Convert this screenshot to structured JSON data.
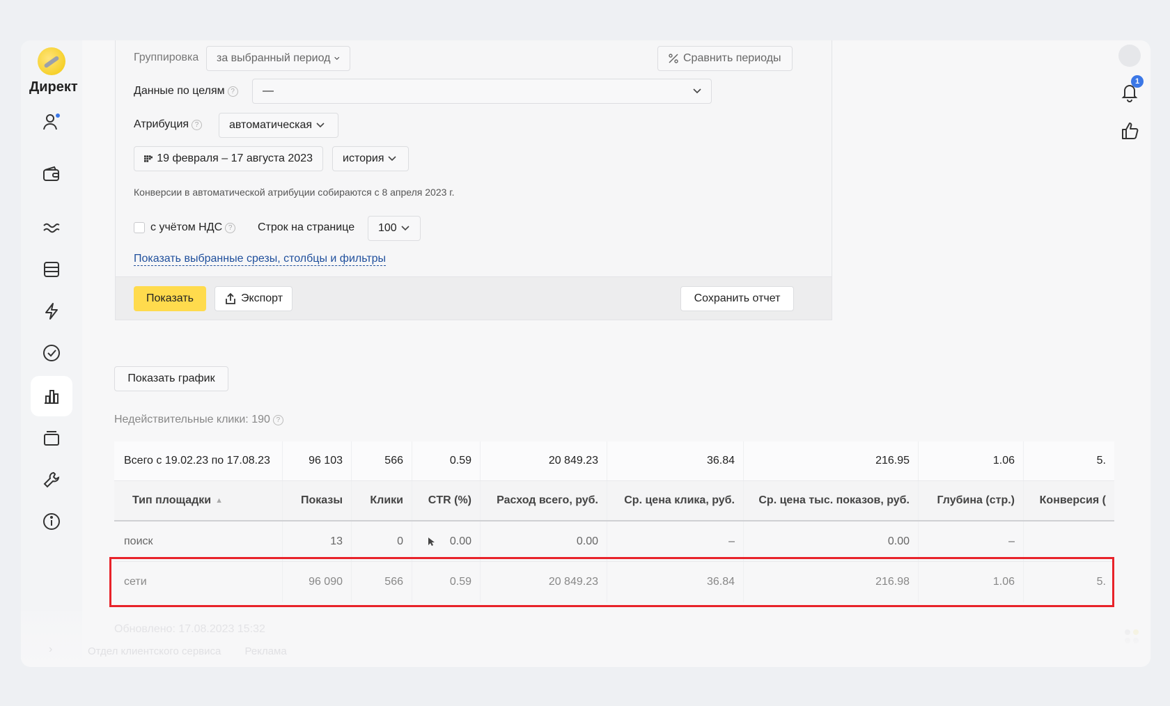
{
  "app": {
    "brand": "Директ",
    "notifications_count": "1"
  },
  "filters": {
    "grouping_label": "Группировка",
    "grouping_value": "за выбранный период",
    "compare_label": "Сравнить периоды",
    "goals_label": "Данные по целям",
    "goals_value": "—",
    "attribution_label": "Атрибуция",
    "attribution_value": "автоматическая",
    "date_range": "19 февраля – 17 августа 2023",
    "history_value": "история",
    "conversions_note": "Конверсии в автоматической атрибуции собираются с 8 апреля 2023 г.",
    "vat_label": "с учётом НДС",
    "vat_checked": false,
    "rows_label": "Строк на странице",
    "rows_value": "100",
    "show_selected_link": "Показать выбранные срезы, столбцы и фильтры"
  },
  "actions": {
    "show_label": "Показать",
    "export_label": "Экспорт",
    "save_report_label": "Сохранить отчет",
    "show_chart_label": "Показать график"
  },
  "stats": {
    "invalid_clicks": "Недействительные клики: 190"
  },
  "table": {
    "total": [
      "Всего с 19.02.23 по 17.08.23",
      "96 103",
      "566",
      "0.59",
      "20 849.23",
      "36.84",
      "216.95",
      "1.06",
      "5."
    ],
    "columns": [
      "Тип площадки",
      "Показы",
      "Клики",
      "CTR (%)",
      "Расход всего, руб.",
      "Ср. цена клика, руб.",
      "Ср. цена тыс. показов, руб.",
      "Глубина (стр.)",
      "Конверсия ("
    ],
    "rows": [
      [
        "поиск",
        "13",
        "0",
        "0.00",
        "0.00",
        "–",
        "0.00",
        "–",
        ""
      ],
      [
        "сети",
        "96 090",
        "566",
        "0.59",
        "20 849.23",
        "36.84",
        "216.98",
        "1.06",
        "5."
      ]
    ],
    "highlighted_row": "сети"
  },
  "footer": {
    "updated": "Обновлено: 17.08.2023 15:32",
    "links": [
      "Отдел клиентского сервиса",
      "Реклама"
    ]
  },
  "colors": {
    "accent_yellow": "#ffdb4d",
    "link_blue": "#1f4f9c",
    "highlight_red": "#e8232a",
    "badge_blue": "#3b77e6"
  }
}
